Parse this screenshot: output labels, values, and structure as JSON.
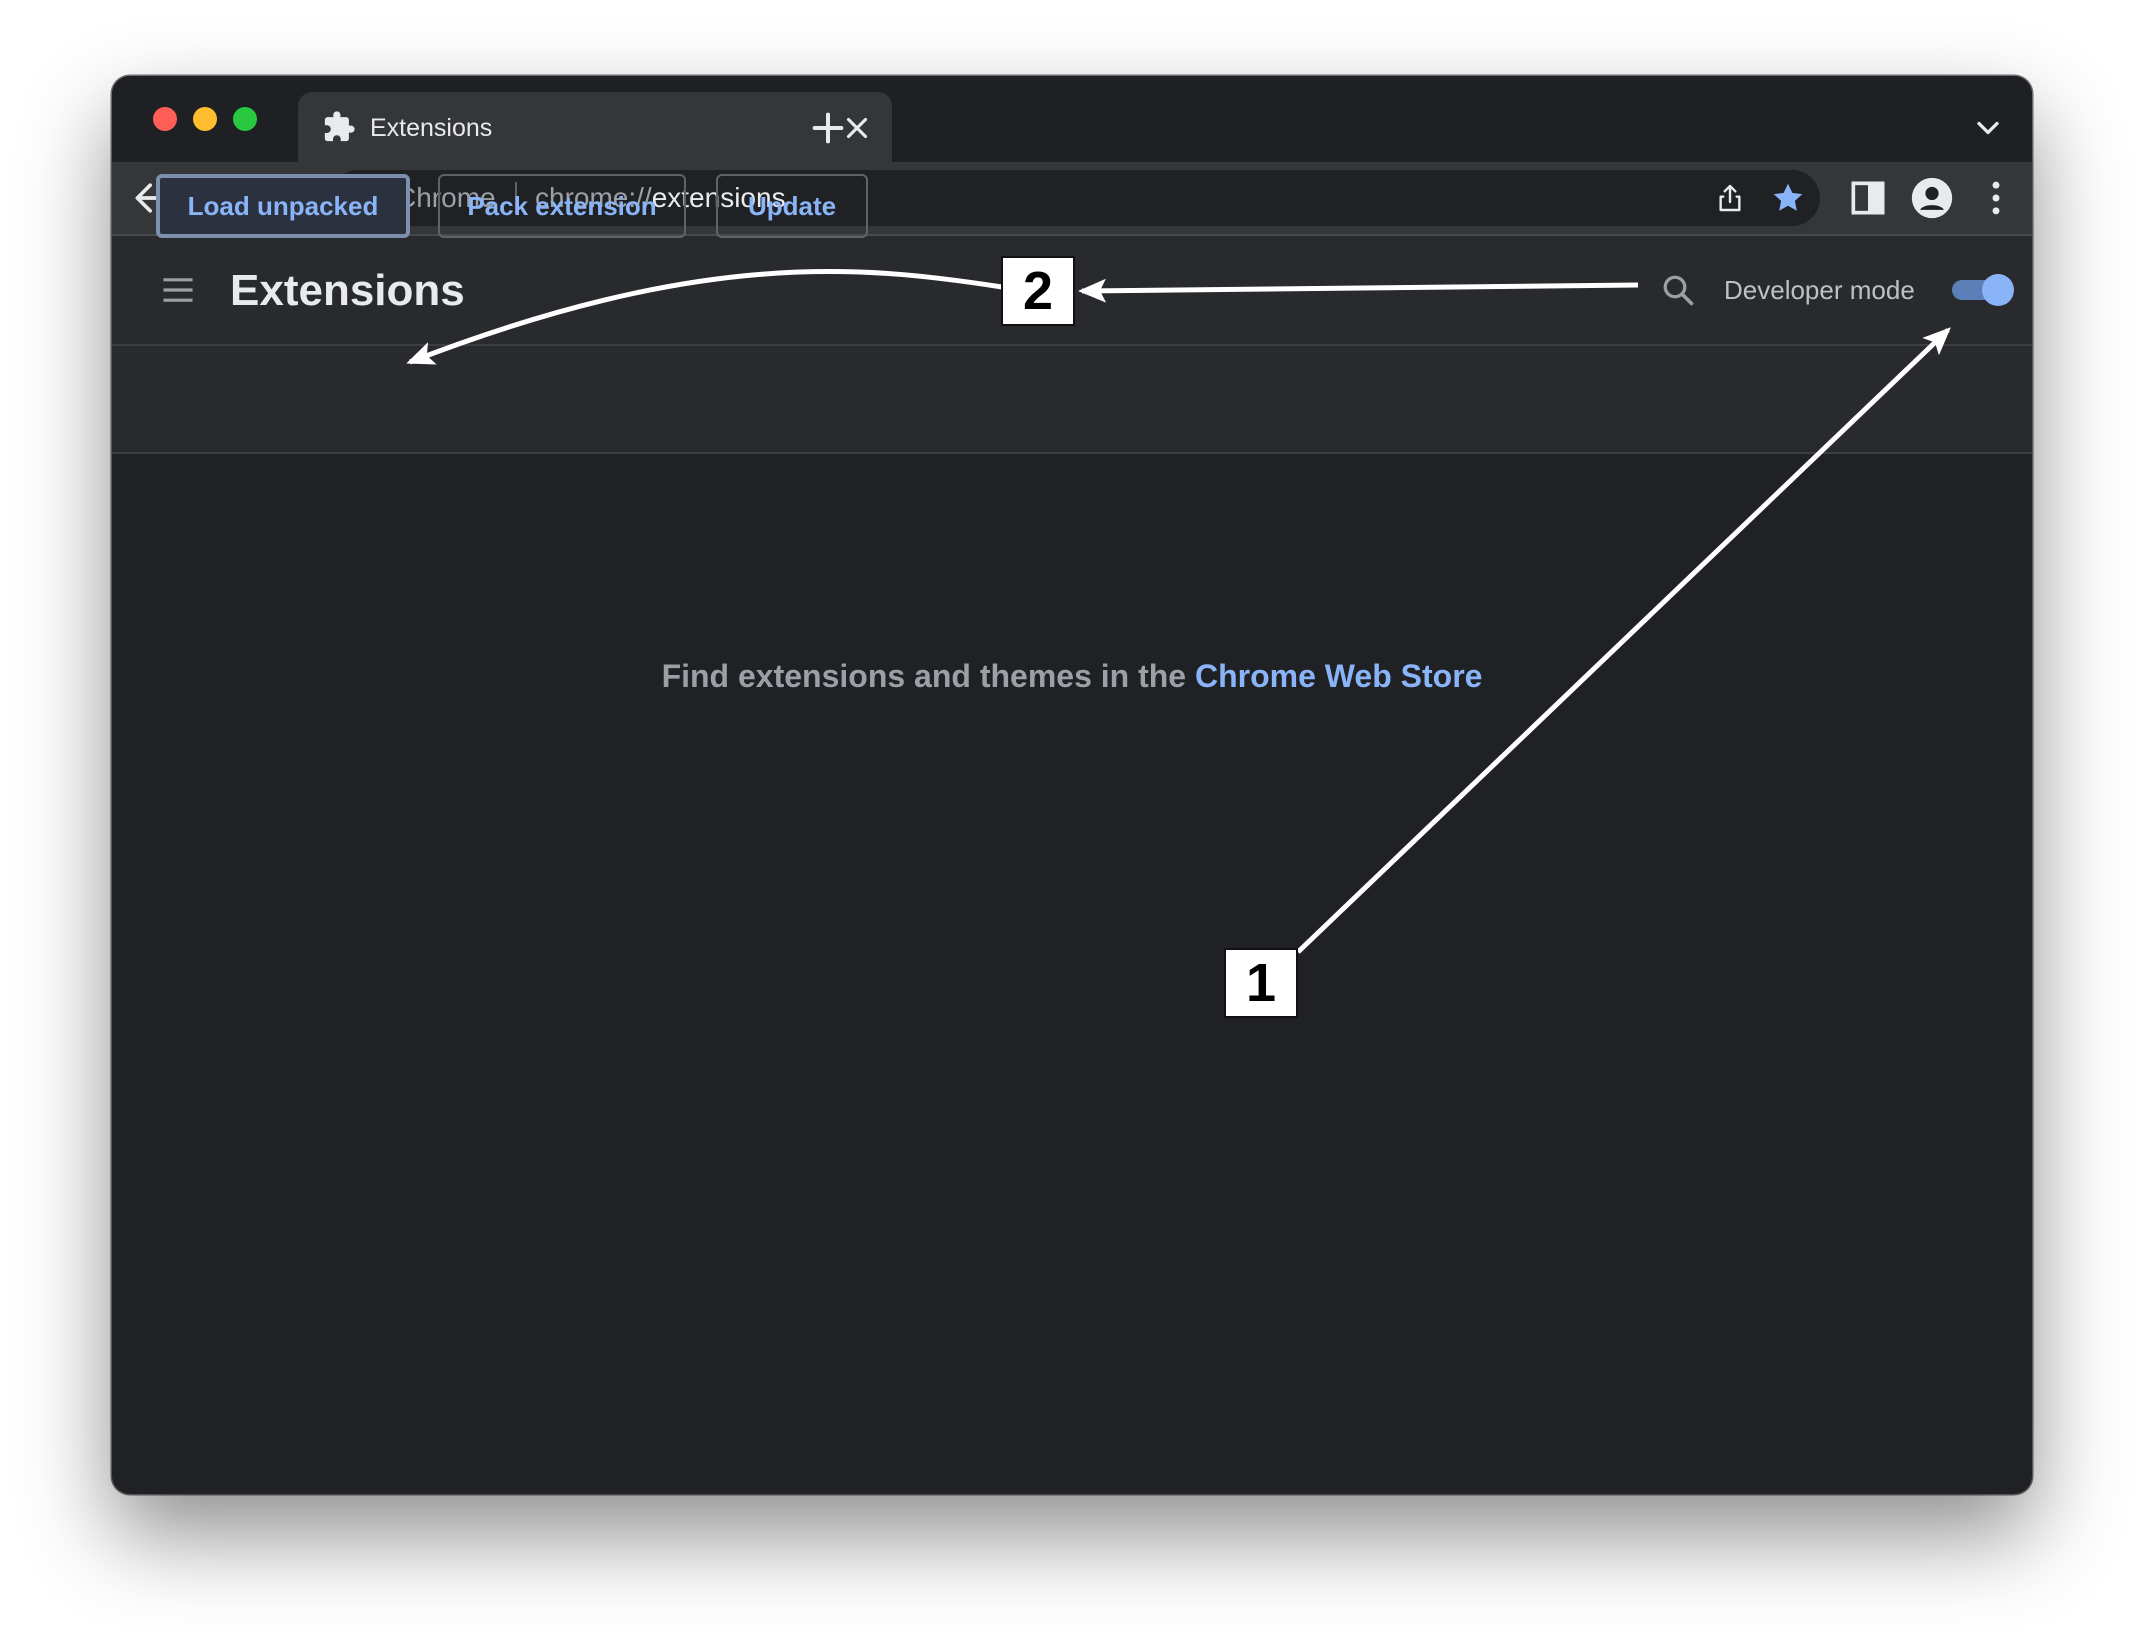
{
  "window": {
    "traffic_lights": [
      "close",
      "minimize",
      "zoom"
    ]
  },
  "tab": {
    "icon": "puzzle-piece-icon",
    "title": "Extensions",
    "close_icon": "close-icon"
  },
  "toolbar": {
    "site_label": "Chrome",
    "url_prefix": "chrome://",
    "url_host": "extensions",
    "icons": [
      "back-arrow-icon",
      "forward-arrow-icon",
      "reload-icon",
      "share-icon",
      "bookmark-star-icon",
      "side-panel-icon",
      "profile-icon",
      "more-vert-icon"
    ]
  },
  "extensions": {
    "title": "Extensions",
    "developer_mode_label": "Developer mode",
    "developer_mode_on": true,
    "buttons": {
      "load_unpacked": "Load unpacked",
      "pack_extension": "Pack extension",
      "update": "Update"
    },
    "empty_text": "Find extensions and themes in the ",
    "empty_link": "Chrome Web Store"
  },
  "annotations": {
    "step1": "1",
    "step2": "2"
  },
  "colors": {
    "accent": "#8ab4f8",
    "background": "#202124",
    "header": "#292a2d",
    "toolbar": "#35363a"
  }
}
